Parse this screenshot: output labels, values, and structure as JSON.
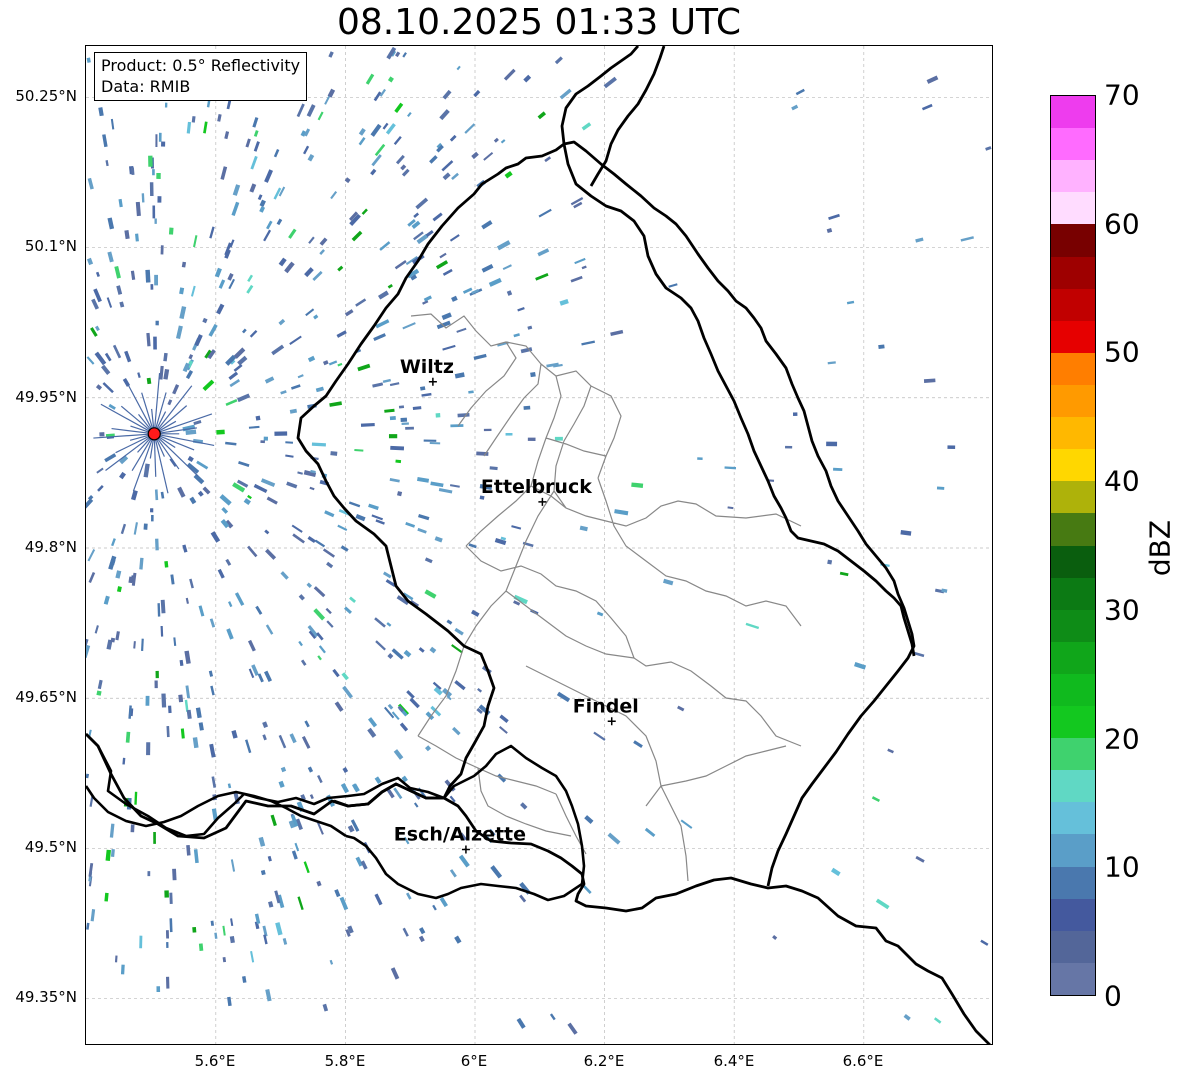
{
  "title": "08.10.2025 01:33 UTC",
  "info": {
    "product": "Product: 0.5° Reflectivity",
    "data": "Data: RMIB"
  },
  "lat_labels": [
    "50.25°N",
    "50.1°N",
    "49.95°N",
    "49.8°N",
    "49.65°N",
    "49.5°N",
    "49.35°N"
  ],
  "lon_labels": [
    "5.6°E",
    "5.8°E",
    "6°E",
    "6.2°E",
    "6.4°E",
    "6.6°E"
  ],
  "cities": [
    {
      "name": "Wiltz",
      "lon": 5.935,
      "lat": 49.966
    },
    {
      "name": "Ettelbruck",
      "lon": 6.104,
      "lat": 49.846
    },
    {
      "name": "Findel",
      "lon": 6.211,
      "lat": 49.627
    },
    {
      "name": "Esch/Alzette",
      "lon": 5.986,
      "lat": 49.499
    }
  ],
  "radar_site": {
    "lon": 5.505,
    "lat": 49.914
  },
  "colorbar": {
    "label": "dBZ",
    "ticks": [
      "0",
      "10",
      "20",
      "30",
      "40",
      "50",
      "60",
      "70"
    ],
    "colors": [
      "#6676a6",
      "#536699",
      "#44599e",
      "#4a78ae",
      "#5a9ec8",
      "#65c0da",
      "#60d8c4",
      "#3fd26e",
      "#13c81f",
      "#10ba1e",
      "#10a61a",
      "#0e8c17",
      "#0c7a14",
      "#0a5e0e",
      "#477a12",
      "#aeb20a",
      "#ffd700",
      "#ffb800",
      "#ff9a00",
      "#ff7e00",
      "#e60000",
      "#c10000",
      "#9e0000",
      "#780000",
      "#ffdcff",
      "#ffb2ff",
      "#ff6bff",
      "#ee3cee"
    ]
  }
}
